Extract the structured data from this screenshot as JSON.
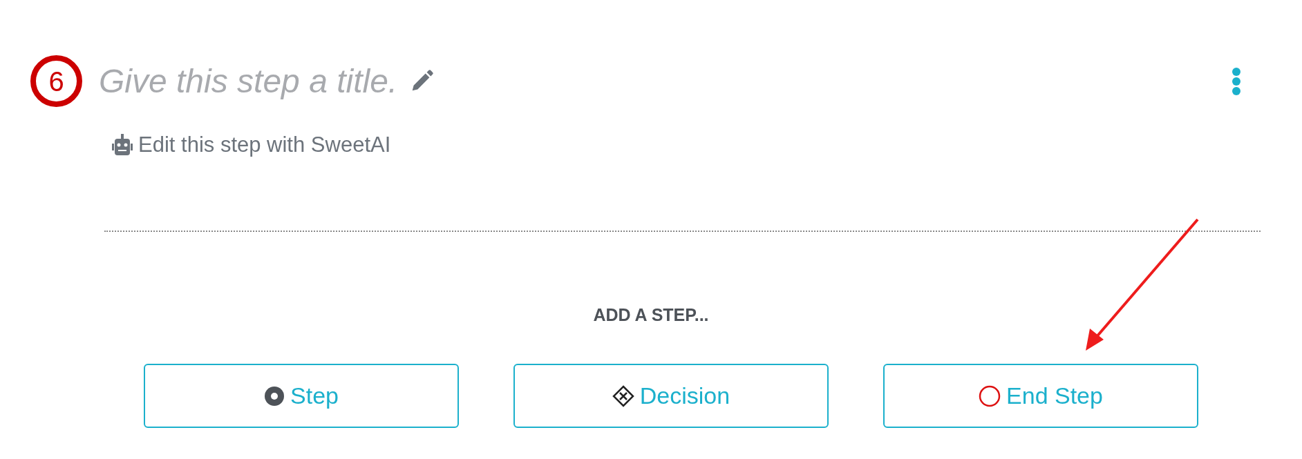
{
  "step": {
    "number": "6",
    "title": "Give this step a title.",
    "ai_link": "Edit this step with SweetAI"
  },
  "add_step": {
    "heading": "ADD A STEP...",
    "buttons": [
      {
        "kind": "step",
        "label": "Step"
      },
      {
        "kind": "decision",
        "label": "Decision"
      },
      {
        "kind": "end",
        "label": "End Step"
      }
    ]
  }
}
